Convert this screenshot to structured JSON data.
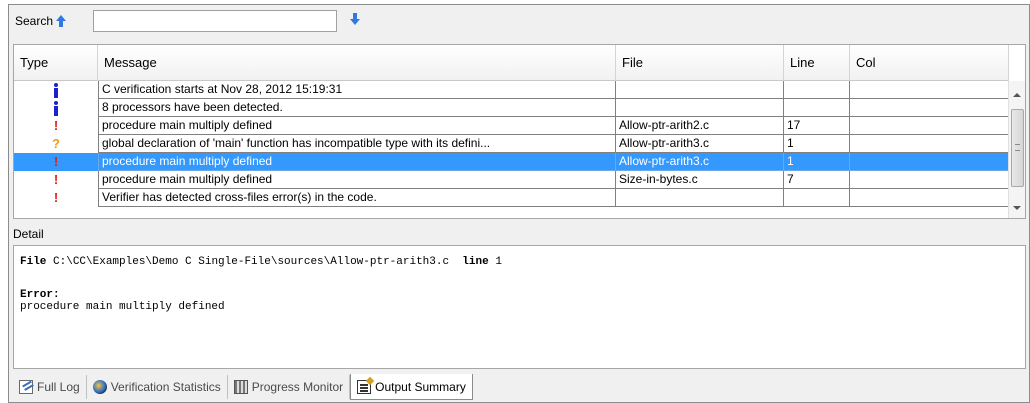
{
  "search": {
    "label": "Search",
    "value": "",
    "placeholder": ""
  },
  "table": {
    "columns": [
      "Type",
      "Message",
      "File",
      "Line",
      "Col"
    ],
    "rows": [
      {
        "type": "info",
        "message": "C verification starts at Nov 28, 2012 15:19:31",
        "file": "",
        "line": "",
        "col": ""
      },
      {
        "type": "info",
        "message": "8 processors have been detected.",
        "file": "",
        "line": "",
        "col": ""
      },
      {
        "type": "error",
        "message": "procedure main multiply defined",
        "file": "Allow-ptr-arith2.c",
        "line": "17",
        "col": ""
      },
      {
        "type": "warning",
        "message": "global declaration of 'main' function has incompatible type with its defini...",
        "file": "Allow-ptr-arith3.c",
        "line": "1",
        "col": ""
      },
      {
        "type": "error",
        "message": "procedure main multiply defined",
        "file": "Allow-ptr-arith3.c",
        "line": "1",
        "col": "",
        "selected": true
      },
      {
        "type": "error",
        "message": "procedure main multiply defined",
        "file": "Size-in-bytes.c",
        "line": "7",
        "col": ""
      },
      {
        "type": "error",
        "message": "Verifier has detected cross-files error(s) in the code.",
        "file": "",
        "line": "",
        "col": ""
      }
    ]
  },
  "detail": {
    "label": "Detail",
    "file_keyword": "File",
    "file_path": "C:\\CC\\Examples\\Demo C Single-File\\sources\\Allow-ptr-arith3.c",
    "line_keyword": "line",
    "line_value": "1",
    "error_label": "Error:",
    "error_text": "procedure main multiply defined"
  },
  "tabs": [
    {
      "label": "Full Log",
      "icon": "log-icon",
      "active": false
    },
    {
      "label": "Verification Statistics",
      "icon": "statistics-icon",
      "active": false
    },
    {
      "label": "Progress Monitor",
      "icon": "monitor-icon",
      "active": false
    },
    {
      "label": "Output Summary",
      "icon": "summary-icon",
      "active": true
    }
  ],
  "colors": {
    "selection": "#3399ff",
    "info_icon": "#1a22c8",
    "error_icon": "#e0201a",
    "warning_icon": "#f09a1c"
  }
}
